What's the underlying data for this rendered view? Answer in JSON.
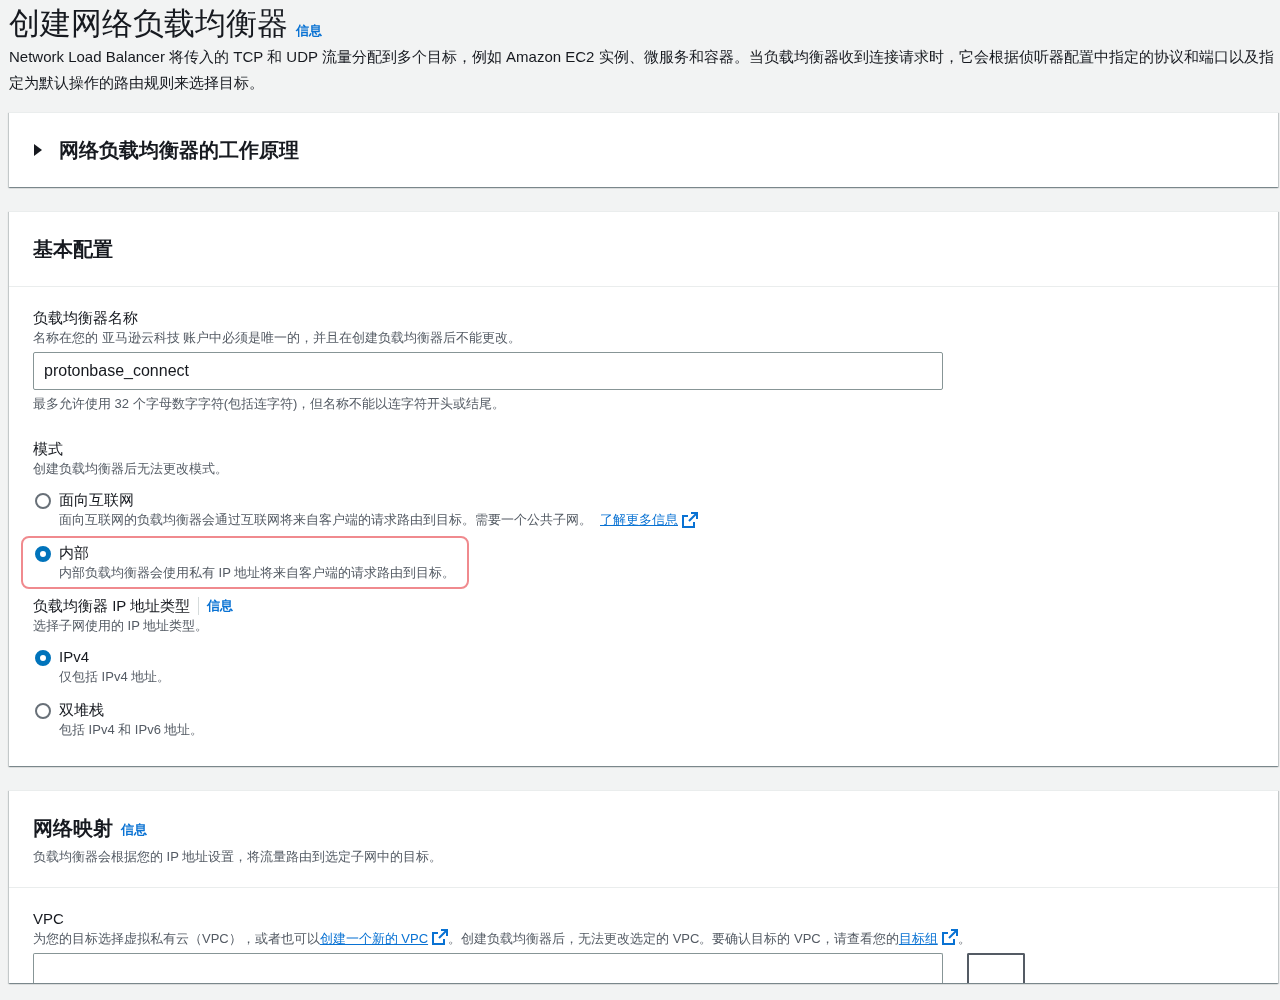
{
  "page": {
    "title": "创建网络负载均衡器",
    "info_link": "信息",
    "description": "Network Load Balancer 将传入的 TCP 和 UDP 流量分配到多个目标，例如 Amazon EC2 实例、微服务和容器。当负载均衡器收到连接请求时，它会根据侦听器配置中指定的协议和端口以及指定为默认操作的路由规则来选择目标。"
  },
  "expander": {
    "title": "网络负载均衡器的工作原理",
    "expanded": false
  },
  "basic_config": {
    "title": "基本配置",
    "name_field": {
      "label": "负载均衡器名称",
      "description": "名称在您的 亚马逊云科技 账户中必须是唯一的，并且在创建负载均衡器后不能更改。",
      "value": "protonbase_connect",
      "constraint": "最多允许使用 32 个字母数字字符(包括连字符)，但名称不能以连字符开头或结尾。"
    },
    "scheme": {
      "label": "模式",
      "description": "创建负载均衡器后无法更改模式。",
      "options": [
        {
          "label": "面向互联网",
          "description": "面向互联网的负载均衡器会通过互联网将来自客户端的请求路由到目标。需要一个公共子网。",
          "link": "了解更多信息",
          "selected": false,
          "highlighted": false
        },
        {
          "label": "内部",
          "description": "内部负载均衡器会使用私有 IP 地址将来自客户端的请求路由到目标。",
          "selected": true,
          "highlighted": true
        }
      ]
    },
    "ip_type": {
      "label": "负载均衡器 IP 地址类型",
      "info_link": "信息",
      "description": "选择子网使用的 IP 地址类型。",
      "options": [
        {
          "label": "IPv4",
          "description": "仅包括 IPv4 地址。",
          "selected": true,
          "highlighted": false
        },
        {
          "label": "双堆栈",
          "description": "包括 IPv4 和 IPv6 地址。",
          "selected": false,
          "highlighted": false
        }
      ]
    }
  },
  "network_mapping": {
    "title": "网络映射",
    "info_link": "信息",
    "description": "负载均衡器会根据您的 IP 地址设置，将流量路由到选定子网中的目标。",
    "vpc": {
      "label": "VPC",
      "description": [
        {
          "kind": "text",
          "text": "为您的目标选择虚拟私有云（VPC），或者也可以"
        },
        {
          "kind": "link",
          "text": "创建一个新的 VPC"
        },
        {
          "kind": "text",
          "text": "。创建负载均衡器后，无法更改选定的 VPC。要确认目标的 VPC，请查看您的"
        },
        {
          "kind": "link",
          "text": "目标组"
        },
        {
          "kind": "text",
          "text": "。"
        }
      ]
    }
  }
}
